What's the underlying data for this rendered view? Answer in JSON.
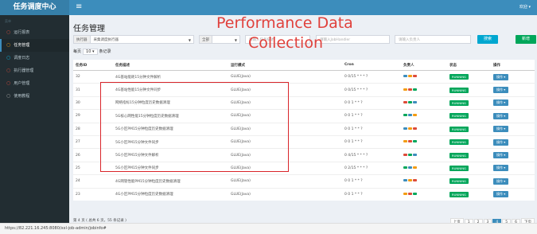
{
  "app": {
    "title": "任务调度中心",
    "user_menu": "欢迎 ▾"
  },
  "sidebar": {
    "header": "菜单",
    "items": [
      {
        "label": "运行报表",
        "color": "#dd4b39",
        "active": false
      },
      {
        "label": "任务管理",
        "color": "#f39c12",
        "active": true
      },
      {
        "label": "调度日志",
        "color": "#00c0ef",
        "active": false
      },
      {
        "label": "执行器管理",
        "color": "#dd4b39",
        "active": false
      },
      {
        "label": "用户管理",
        "color": "#dd4b39",
        "active": false
      },
      {
        "label": "使用教程",
        "color": "#aaaaaa",
        "active": false
      }
    ]
  },
  "page": {
    "title": "任务管理"
  },
  "filters": {
    "executor": {
      "label": "执行器",
      "value": "采集调度执行器"
    },
    "status": {
      "label": "全部",
      "value": "全部"
    },
    "desc_placeholder": "请输入任务描述",
    "handler_placeholder": "请输入JobHandler",
    "owner_placeholder": "请输入负责人",
    "search_label": "搜索",
    "add_label": "新增"
  },
  "overlay": {
    "line1": "Performance Data",
    "line2": "Collection",
    "color": "#e0413c"
  },
  "per_page": {
    "prefix": "每页",
    "value": "10",
    "suffix": "条记录"
  },
  "table": {
    "headers": [
      "任务ID",
      "任务描述",
      "运行模式",
      "Cron",
      "负责人",
      "状态",
      "操作"
    ],
    "rows": [
      {
        "id": "32",
        "desc": "4G基站能耗15分钟文件解析",
        "mode": "GLUE(Java)",
        "cron": "0 0/15 * * * ?",
        "status": "RUNNING",
        "op": "操作 ▾"
      },
      {
        "id": "31",
        "desc": "4G基站性能15分钟文件同步",
        "mode": "GLUE(Java)",
        "cron": "0 0/15 * * * ?",
        "status": "RUNNING",
        "op": "操作 ▾"
      },
      {
        "id": "30",
        "desc": "网络指标15分钟粒度历史数据清理",
        "mode": "GLUE(Java)",
        "cron": "0 0 1 * * ?",
        "status": "RUNNING",
        "op": "操作 ▾"
      },
      {
        "id": "29",
        "desc": "5G核心网性能15分钟粒度历史数据清理",
        "mode": "GLUE(Java)",
        "cron": "0 0 1 * * ?",
        "status": "RUNNING",
        "op": "操作 ▾"
      },
      {
        "id": "28",
        "desc": "5G小区PM15分钟粒度历史数据清理",
        "mode": "GLUE(Java)",
        "cron": "0 0 1 * * ?",
        "status": "RUNNING",
        "op": "操作 ▾"
      },
      {
        "id": "27",
        "desc": "5G小区PM15分钟文件同步",
        "mode": "GLUE(Java)",
        "cron": "0 0 1 * * ?",
        "status": "RUNNING",
        "op": "操作 ▾"
      },
      {
        "id": "26",
        "desc": "5G小区PM15分钟文件解析",
        "mode": "GLUE(Java)",
        "cron": "0 4/15 * * * ?",
        "status": "RUNNING",
        "op": "操作 ▾"
      },
      {
        "id": "25",
        "desc": "5G小区PM15分钟文件同步",
        "mode": "GLUE(Java)",
        "cron": "0 2/15 * * * ?",
        "status": "RUNNING",
        "op": "操作 ▾"
      },
      {
        "id": "24",
        "desc": "4G网管性能PM15分钟粒度历史数据清理",
        "mode": "GLUE(Java)",
        "cron": "0 0 1 * * ?",
        "status": "RUNNING",
        "op": "操作 ▾"
      },
      {
        "id": "23",
        "desc": "4G小区PM15分钟粒度历史数据清理",
        "mode": "GLUE(Java)",
        "cron": "0 0 1 * * ?",
        "status": "RUNNING",
        "op": "操作 ▾"
      }
    ]
  },
  "footer": {
    "summary": "第 4 页 ( 总共 6 页，55 条记录 )",
    "pages": [
      "上页",
      "1",
      "2",
      "3",
      "4",
      "5",
      "6",
      "下页"
    ],
    "current_page": "4"
  },
  "status_bar": {
    "url": "https://82.221.16.245:8080/xxl-job-admin/jobinfo#"
  }
}
